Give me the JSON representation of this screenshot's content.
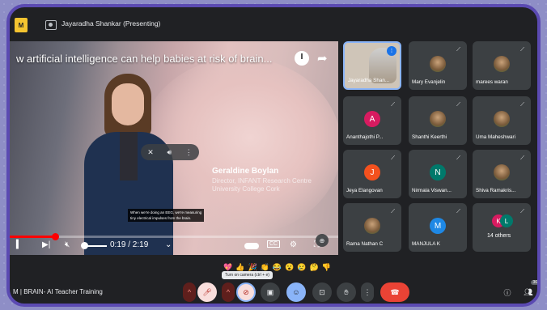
{
  "topbar": {
    "logo_text": "M",
    "presenter_label": "Jayaradha Shankar (Presenting)"
  },
  "video": {
    "title": "w artificial intelligence can help babies at risk of brain...",
    "speaker_name": "Geraldine Boylan",
    "speaker_role": "Director, INFANT Research Centre",
    "speaker_university": "University College Cork",
    "caption_line1": "When we're doing an EEG, we're measuring",
    "caption_line2": "tiny electrical impulses from the brain.",
    "time": "0:19 / 2:19",
    "progress_fraction": 0.137,
    "cc_label": "CC"
  },
  "participants": [
    {
      "name": "Jayaradha Shan...",
      "active": true
    },
    {
      "name": "Mary Evanjelin",
      "avatar": "photo"
    },
    {
      "name": "marees waran",
      "avatar": "photo"
    },
    {
      "name": "Ananthajothi P...",
      "initial": "A",
      "color": "#d81b60"
    },
    {
      "name": "Shanthi Keerthi",
      "avatar": "photo"
    },
    {
      "name": "Uma Maheshwari",
      "avatar": "photo"
    },
    {
      "name": "Jeya Elangovan",
      "initial": "J",
      "color": "#f4511e"
    },
    {
      "name": "Nirmala Viswan...",
      "initial": "N",
      "color": "#00796b"
    },
    {
      "name": "Shiva Ramakris...",
      "avatar": "photo"
    },
    {
      "name": "Rama Nathan C",
      "avatar": "photo"
    },
    {
      "name": "MANJULA K",
      "initial": "M",
      "color": "#1e88e5"
    },
    {
      "name": "14 others",
      "others": [
        "K",
        "L"
      ]
    }
  ],
  "reactions": [
    "💖",
    "👍",
    "🎉",
    "👏",
    "😂",
    "😮",
    "😢",
    "🤔",
    "👎"
  ],
  "tooltip": "Turn on camera (ctrl + e)",
  "bottombar": {
    "meeting_label": "M  |  BRAIN- AI Teacher Training",
    "people_count": "36"
  }
}
